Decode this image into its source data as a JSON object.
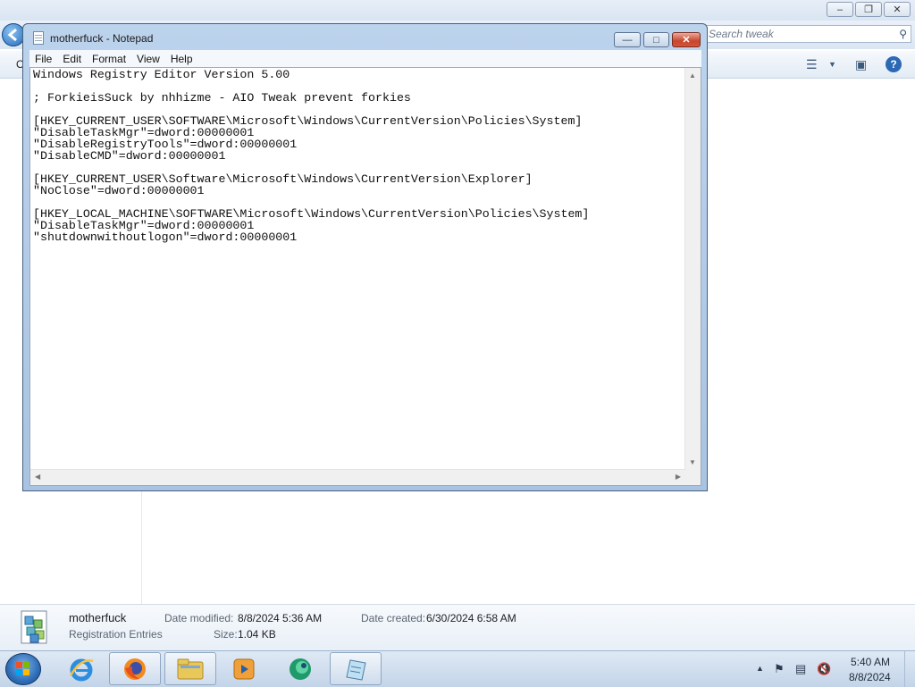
{
  "explorer": {
    "search_placeholder": "Search tweak",
    "details": {
      "file_name": "motherfuck",
      "file_type": "Registration Entries",
      "date_modified_label": "Date modified:",
      "date_modified": "8/8/2024 5:36 AM",
      "date_created_label": "Date created:",
      "date_created": "6/30/2024 6:58 AM",
      "size_label": "Size:",
      "size": "1.04 KB"
    }
  },
  "notepad": {
    "title": "motherfuck - Notepad",
    "menu": [
      "File",
      "Edit",
      "Format",
      "View",
      "Help"
    ],
    "lines": [
      "Windows Registry Editor Version 5.00",
      "",
      "; ForkieisSuck by nhhizme - AIO Tweak prevent forkies",
      "",
      "[HKEY_CURRENT_USER\\SOFTWARE\\Microsoft\\Windows\\CurrentVersion\\Policies\\System]",
      "\"DisableTaskMgr\"=dword:00000001",
      "\"DisableRegistryTools\"=dword:00000001",
      "\"DisableCMD\"=dword:00000001",
      "",
      "[HKEY_CURRENT_USER\\Software\\Microsoft\\Windows\\CurrentVersion\\Explorer]",
      "\"NoClose\"=dword:00000001",
      "",
      "[HKEY_LOCAL_MACHINE\\SOFTWARE\\Microsoft\\Windows\\CurrentVersion\\Policies\\System]",
      "\"DisableTaskMgr\"=dword:00000001",
      "\"shutdownwithoutlogon\"=dword:00000001"
    ]
  },
  "taskbar": {
    "pinned": [
      "internet-explorer",
      "firefox",
      "file-explorer",
      "media-player",
      "app-green-globe",
      "notepad"
    ],
    "clock_time": "5:40 AM",
    "clock_date": "8/8/2024"
  }
}
